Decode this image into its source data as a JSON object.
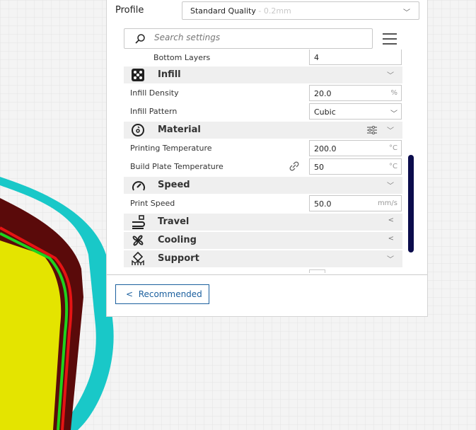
{
  "profile": {
    "label": "Profile",
    "value": "Standard Quality",
    "sub": " - 0.2mm"
  },
  "search": {
    "placeholder": "Search settings"
  },
  "settings": {
    "bottom_layers": {
      "label": "Bottom Layers",
      "value": "4"
    },
    "infill": {
      "title": "Infill",
      "density": {
        "label": "Infill Density",
        "value": "20.0",
        "unit": "%"
      },
      "pattern": {
        "label": "Infill Pattern",
        "value": "Cubic"
      }
    },
    "material": {
      "title": "Material",
      "print_temp": {
        "label": "Printing Temperature",
        "value": "200.0",
        "unit": "°C"
      },
      "plate_temp": {
        "label": "Build Plate Temperature",
        "value": "50",
        "unit": "°C"
      }
    },
    "speed": {
      "title": "Speed",
      "print_speed": {
        "label": "Print Speed",
        "value": "50.0",
        "unit": "mm/s"
      }
    },
    "travel": {
      "title": "Travel"
    },
    "cooling": {
      "title": "Cooling"
    },
    "support": {
      "title": "Support"
    }
  },
  "footer": {
    "recommended": "Recommended"
  },
  "colors": {
    "accent": "#1b5f9e",
    "scrollbar": "#0b0c4c"
  }
}
